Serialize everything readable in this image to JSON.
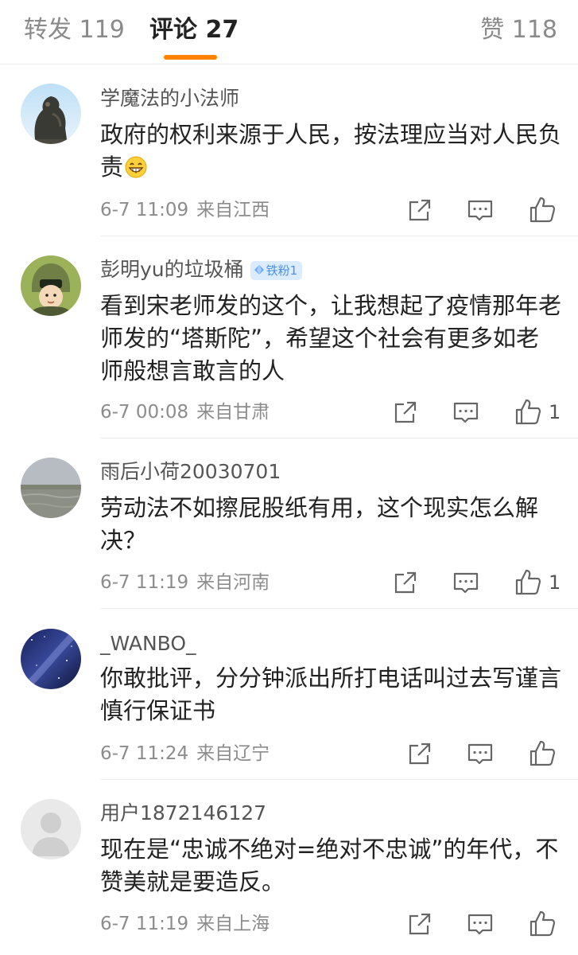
{
  "tabs": {
    "forward_label": "转发 119",
    "comments_label": "评论 27",
    "likes_label": "赞 118"
  },
  "colors": {
    "accent": "#ff8200",
    "badge_bg": "#dcecff",
    "badge_text": "#4b8fe8"
  },
  "icons": [
    "share-icon",
    "reply-icon",
    "thumbs-up-icon",
    "grinning-emoji-icon",
    "diamond-icon"
  ],
  "comments": [
    {
      "username": "学魔法的小法师",
      "text": "政府的权利来源于人民，按法理应当对人民负责",
      "time": "6-7 11:09",
      "location": "来自江西",
      "likes": ""
    },
    {
      "username": "彭明yu的垃圾桶",
      "badge": "铁粉1",
      "text": "看到宋老师发的这个，让我想起了疫情那年老师发的“塔斯陀”，希望这个社会有更多如老师般想言敢言的人",
      "time": "6-7 00:08",
      "location": "来自甘肃",
      "likes": "1"
    },
    {
      "username": "雨后小荷20030701",
      "text": "劳动法不如擦屁股纸有用，这个现实怎么解决？",
      "time": "6-7 11:19",
      "location": "来自河南",
      "likes": "1"
    },
    {
      "username": "_WANBO_",
      "text": "你敢批评，分分钟派出所打电话叫过去写谨言慎行保证书",
      "time": "6-7 11:24",
      "location": "来自辽宁",
      "likes": ""
    },
    {
      "username": "用户1872146127",
      "text": "现在是“忠诚不绝对=绝对不忠诚”的年代，不赞美就是要造反。",
      "time": "6-7 11:19",
      "location": "来自上海",
      "likes": ""
    }
  ]
}
